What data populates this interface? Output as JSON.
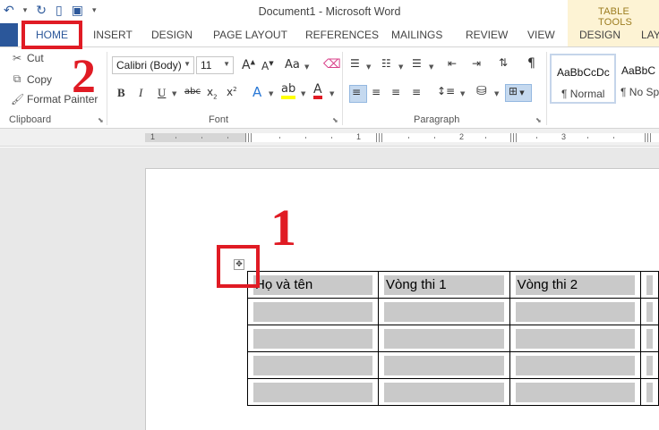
{
  "window": {
    "title": "Document1 - Microsoft Word",
    "contextual_tab_group": "TABLE TOOLS"
  },
  "quick_access": [
    "undo-icon",
    "redo-icon",
    "new-document-icon",
    "save-icon",
    "customize-icon"
  ],
  "tabs": [
    {
      "label": "HOME"
    },
    {
      "label": "INSERT"
    },
    {
      "label": "DESIGN"
    },
    {
      "label": "PAGE LAYOUT"
    },
    {
      "label": "REFERENCES"
    },
    {
      "label": "MAILINGS"
    },
    {
      "label": "REVIEW"
    },
    {
      "label": "VIEW"
    },
    {
      "label": "DESIGN"
    },
    {
      "label": "LAY"
    }
  ],
  "clipboard": {
    "cut": "Cut",
    "copy": "Copy",
    "format_painter": "Format Painter",
    "group_label": "Clipboard"
  },
  "font": {
    "font_name": "Calibri (Body)",
    "font_size": "11",
    "group_label": "Font"
  },
  "paragraph": {
    "group_label": "Paragraph"
  },
  "styles": [
    {
      "sample": "AaBbCcDc",
      "name": "¶ Normal"
    },
    {
      "sample": "AaBbC",
      "name": "¶ No Spa"
    }
  ],
  "ruler": {
    "numbers": [
      "1",
      "1",
      "2",
      "3"
    ]
  },
  "annotations": {
    "step1": "1",
    "step2": "2"
  },
  "table": {
    "headers": [
      "Họ và tên",
      "Vòng thi 1",
      "Vòng thi 2",
      ""
    ],
    "empty_rows": 5
  },
  "colors": {
    "accent": "#2b579a",
    "annotation": "#e01b24",
    "cell_shade": "#c9c9c9",
    "contextual_bg": "#fdf3d4"
  }
}
